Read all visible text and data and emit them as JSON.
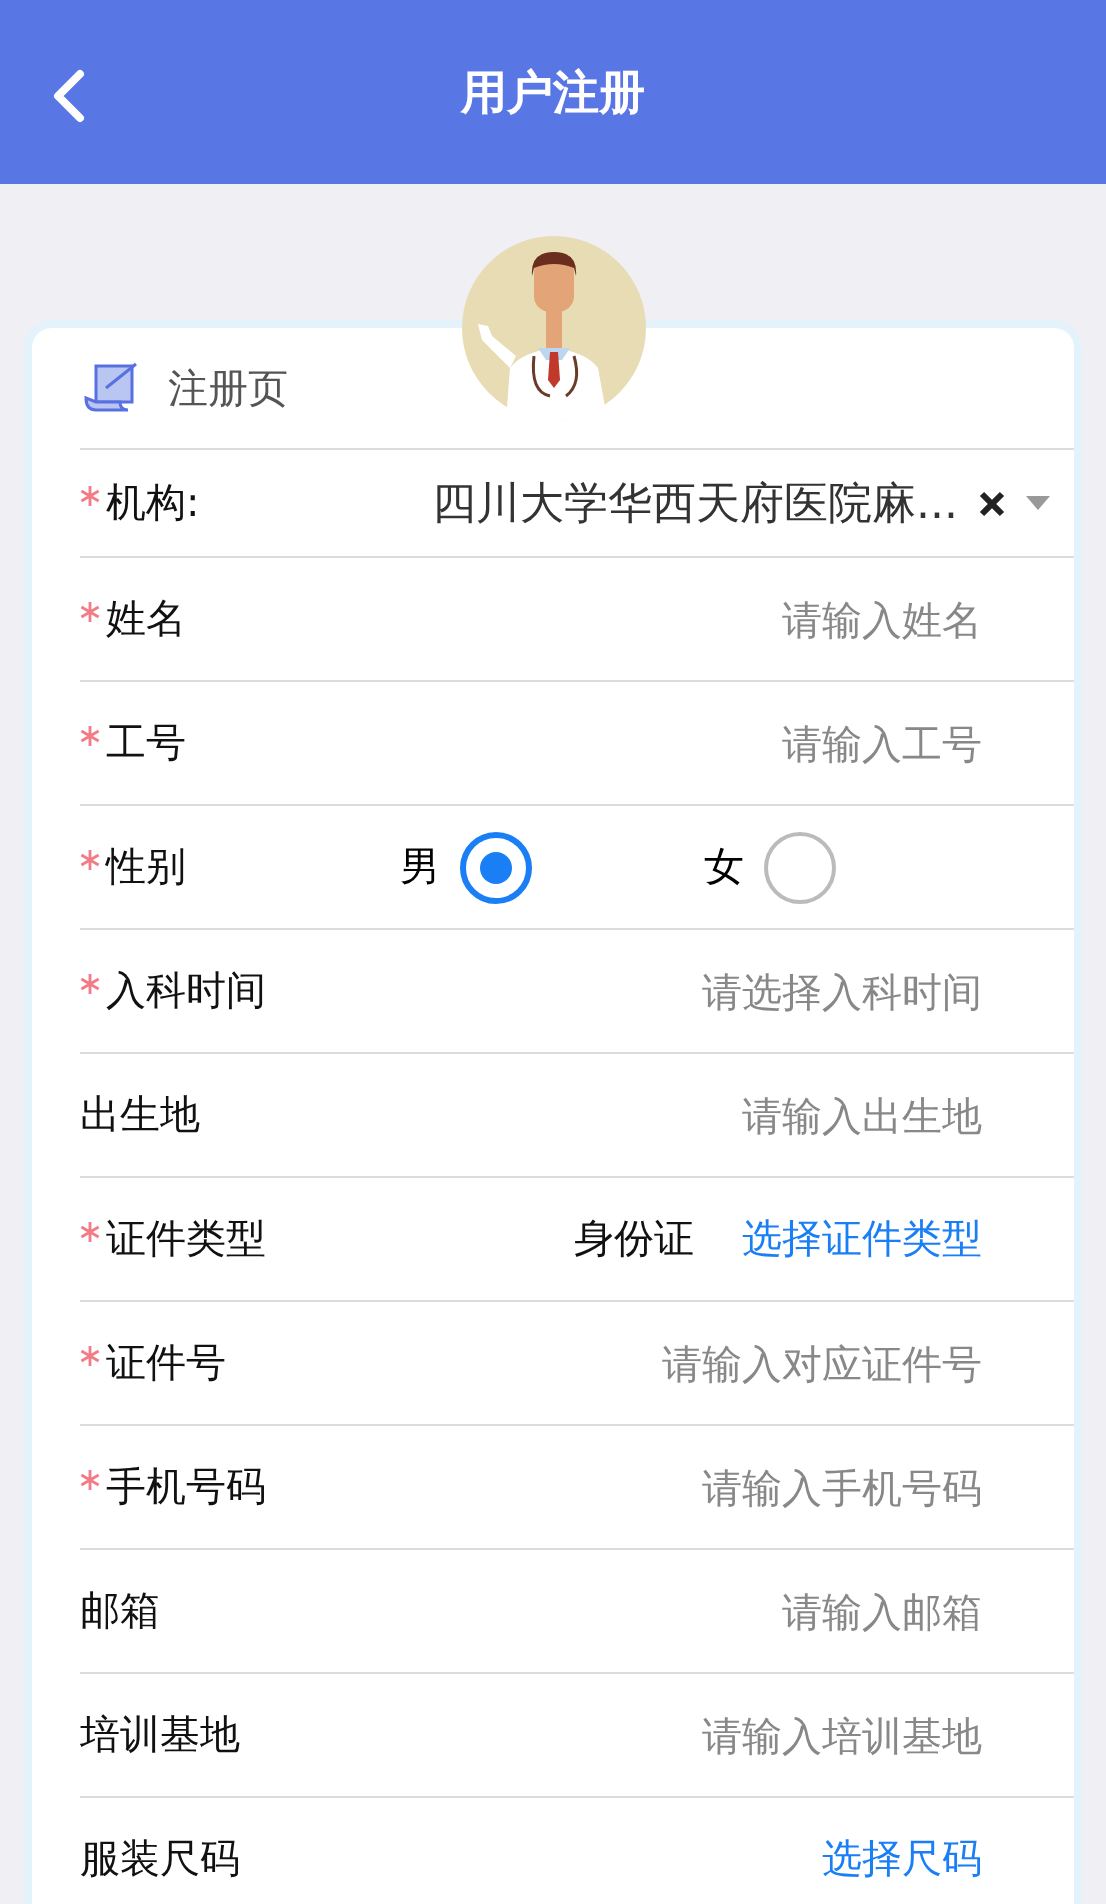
{
  "header": {
    "title": "用户注册"
  },
  "card": {
    "title": "注册页"
  },
  "fields": [
    {
      "kind": "select",
      "label": "机构:",
      "required": true,
      "value": "四川大学华西天府医院麻..."
    },
    {
      "kind": "input",
      "label": "姓名",
      "required": true,
      "placeholder": "请输入姓名"
    },
    {
      "kind": "input",
      "label": "工号",
      "required": true,
      "placeholder": "请输入工号"
    },
    {
      "kind": "radio",
      "label": "性别",
      "required": true,
      "options": [
        {
          "label": "男",
          "selected": true
        },
        {
          "label": "女",
          "selected": false
        }
      ]
    },
    {
      "kind": "input",
      "label": "入科时间",
      "required": true,
      "placeholder": "请选择入科时间"
    },
    {
      "kind": "input",
      "label": "出生地",
      "required": false,
      "placeholder": "请输入出生地"
    },
    {
      "kind": "choice",
      "label": "证件类型",
      "required": true,
      "value": "身份证",
      "action": "选择证件类型"
    },
    {
      "kind": "input",
      "label": "证件号",
      "required": true,
      "placeholder": "请输入对应证件号"
    },
    {
      "kind": "input",
      "label": "手机号码",
      "required": true,
      "placeholder": "请输入手机号码"
    },
    {
      "kind": "input",
      "label": "邮箱",
      "required": false,
      "placeholder": "请输入邮箱"
    },
    {
      "kind": "input",
      "label": "培训基地",
      "required": false,
      "placeholder": "请输入培训基地"
    },
    {
      "kind": "choice",
      "label": "服装尺码",
      "required": false,
      "action": "选择尺码"
    }
  ]
}
